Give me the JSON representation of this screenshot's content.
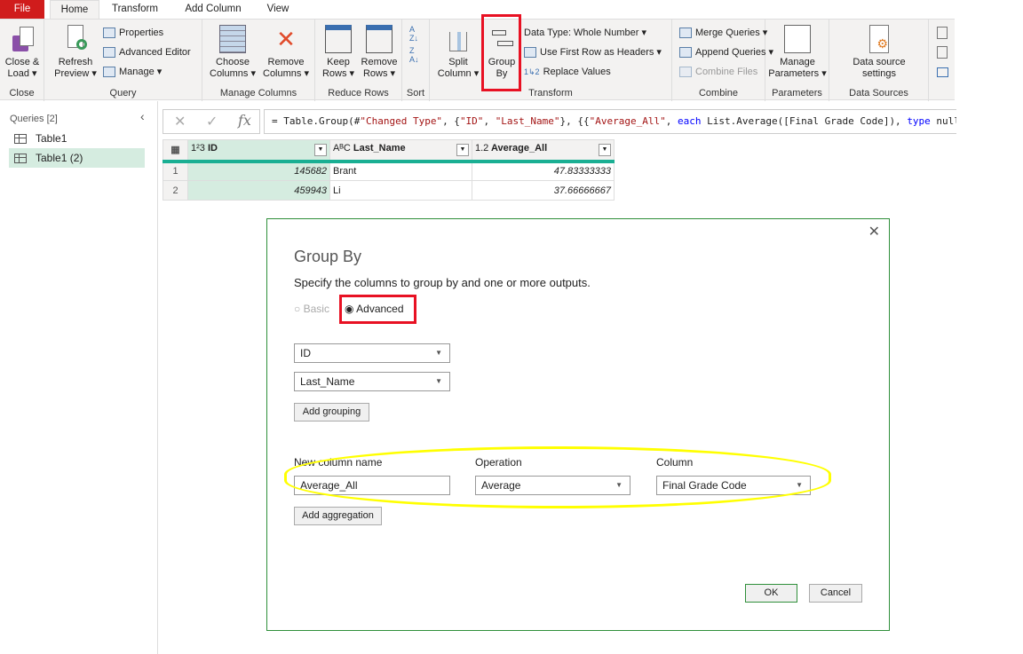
{
  "tabs": [
    "File",
    "Home",
    "Transform",
    "Add Column",
    "View"
  ],
  "ribbon": {
    "close": {
      "btn": [
        "Close &",
        "Load ▾"
      ],
      "label": "Close"
    },
    "query": {
      "refresh": [
        "Refresh",
        "Preview ▾"
      ],
      "properties": "Properties",
      "advanced_editor": "Advanced Editor",
      "manage": "Manage ▾",
      "label": "Query"
    },
    "manage_columns": {
      "choose": [
        "Choose",
        "Columns ▾"
      ],
      "remove": [
        "Remove",
        "Columns ▾"
      ],
      "label": "Manage Columns"
    },
    "reduce_rows": {
      "keep": [
        "Keep",
        "Rows ▾"
      ],
      "remove": [
        "Remove",
        "Rows ▾"
      ],
      "label": "Reduce Rows"
    },
    "sort": {
      "label": "Sort"
    },
    "transform": {
      "split": [
        "Split",
        "Column ▾"
      ],
      "group_by": [
        "Group",
        "By"
      ],
      "data_type": "Data Type: Whole Number ▾",
      "first_row": "Use First Row as Headers ▾",
      "replace": "Replace Values",
      "label": "Transform"
    },
    "combine": {
      "merge": "Merge Queries ▾",
      "append": "Append Queries ▾",
      "combine_files": "Combine Files",
      "label": "Combine"
    },
    "parameters": {
      "manage": [
        "Manage",
        "Parameters ▾"
      ],
      "label": "Parameters"
    },
    "data_sources": {
      "settings": [
        "Data source",
        "settings"
      ],
      "label": "Data Sources"
    }
  },
  "queries": {
    "header": "Queries [2]",
    "items": [
      "Table1",
      "Table1 (2)"
    ]
  },
  "formula": {
    "prefix": "= Table.Group(#",
    "s1": "\"Changed Type\"",
    "p2": ", {",
    "s2": "\"ID\"",
    "p3": ", ",
    "s3": "\"Last_Name\"",
    "p4": "}, {{",
    "s4": "\"Average_All\"",
    "p5": ", ",
    "k1": "each",
    "p6": " List.Average([Final Grade Code]), ",
    "k2": "type",
    "p7": " null"
  },
  "table": {
    "columns": [
      {
        "type": "1²3",
        "name": "ID"
      },
      {
        "type": "AᴮC",
        "name": "Last_Name"
      },
      {
        "type": "1.2",
        "name": "Average_All"
      }
    ],
    "rows": [
      {
        "n": "1",
        "id": "145682",
        "name": "Brant",
        "avg": "47.83333333"
      },
      {
        "n": "2",
        "id": "459943",
        "name": "Li",
        "avg": "37.66666667"
      }
    ]
  },
  "dialog": {
    "title": "Group By",
    "subtitle": "Specify the columns to group by and one or more outputs.",
    "basic": "Basic",
    "advanced": "Advanced",
    "groupings": [
      "ID",
      "Last_Name"
    ],
    "add_grouping": "Add grouping",
    "new_col_label": "New column name",
    "operation_label": "Operation",
    "column_label": "Column",
    "new_col_value": "Average_All",
    "operation_value": "Average",
    "column_value": "Final Grade Code",
    "add_aggregation": "Add aggregation",
    "ok": "OK",
    "cancel": "Cancel"
  },
  "colors": {
    "file_tab": "#d01c1c",
    "highlight_red": "#e81123",
    "highlight_yellow": "#ffff00",
    "accent_teal": "#1aaf93",
    "dialog_border": "#2f8f3a"
  }
}
